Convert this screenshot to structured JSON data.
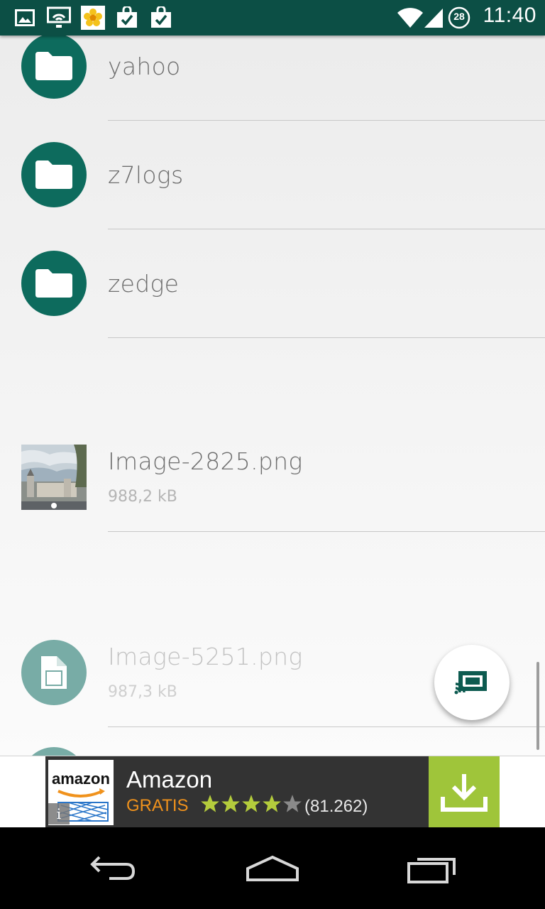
{
  "status_bar": {
    "time": "11:40",
    "battery_level": "28",
    "left_icons": [
      "gallery-icon",
      "cast-wifi-icon",
      "flower-icon",
      "bag-check-icon",
      "bag-check-icon"
    ],
    "background": "#0c4f45"
  },
  "files": [
    {
      "name": "yahoo",
      "type": "folder"
    },
    {
      "name": "z7logs",
      "type": "folder"
    },
    {
      "name": "zedge",
      "type": "folder"
    },
    {
      "name": "Image-2825.png",
      "size": "988,2 kB",
      "type": "image"
    },
    {
      "name": "Image-5251.png",
      "size": "987,3 kB",
      "type": "file"
    }
  ],
  "fab": {
    "icon": "cast-screen-icon"
  },
  "ad": {
    "app_name": "Amazon",
    "logo_text": "amazon",
    "price_label": "GRATIS",
    "rating": 4,
    "rating_max": 5,
    "reviews": "(81.262)",
    "info_label": "i"
  },
  "colors": {
    "accent": "#0d6b5d",
    "file_icon": "#78aca6",
    "ad_download": "#9fc53a",
    "ad_price": "#f0921c"
  }
}
